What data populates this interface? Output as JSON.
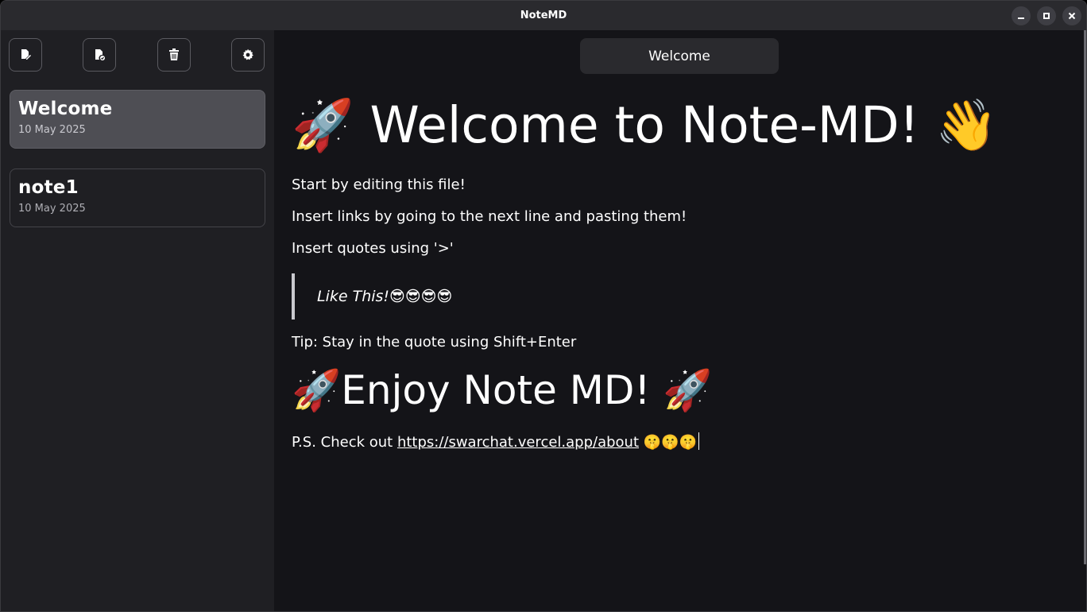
{
  "app": {
    "title": "NoteMD"
  },
  "toolbar": {
    "new_note": "new-note-icon",
    "export_note": "export-note-icon",
    "delete_note": "trash-icon",
    "settings": "gear-icon"
  },
  "notes": [
    {
      "title": "Welcome",
      "date": "10 May 2025",
      "selected": true
    },
    {
      "title": "note1",
      "date": "10 May 2025",
      "selected": false
    }
  ],
  "editor": {
    "note_title": "Welcome",
    "heading1": "🚀 Welcome to Note-MD! 👋",
    "para1": "Start by editing this file!",
    "para2": "Insert links by going to the next line and pasting them!",
    "para3": "Insert quotes using '>'",
    "quote": "Like This!😎😎😎😎",
    "tip": "Tip: Stay in the quote using Shift+Enter",
    "heading2": "🚀Enjoy Note MD! 🚀",
    "ps_prefix": "P.S. Check out ",
    "ps_link": "https://swarchat.vercel.app/about",
    "ps_suffix": " 🤫🤫🤫"
  }
}
